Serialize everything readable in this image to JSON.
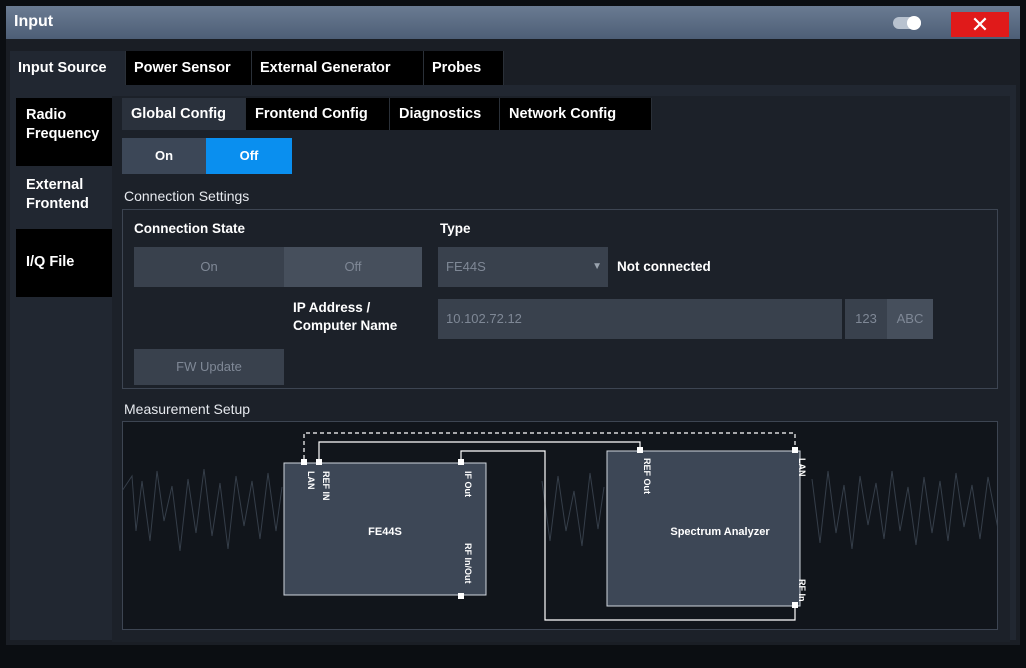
{
  "window": {
    "title": "Input"
  },
  "top_tabs": [
    "Input Source",
    "Power Sensor",
    "External Generator",
    "Probes"
  ],
  "side_tabs": [
    "Radio Frequency",
    "External Frontend",
    "I/Q File"
  ],
  "sub_tabs": [
    "Global Config",
    "Frontend Config",
    "Diagnostics",
    "Network Config"
  ],
  "global_state": {
    "on_label": "On",
    "off_label": "Off",
    "selected": "Off"
  },
  "connection_settings": {
    "title": "Connection Settings",
    "state_label": "Connection State",
    "state_on": "On",
    "state_off": "Off",
    "type_label": "Type",
    "type_value": "FE44S",
    "status": "Not connected",
    "ip_label_line1": "IP Address /",
    "ip_label_line2": "Computer Name",
    "ip_value": "10.102.72.12",
    "keypad_numeric": "123",
    "keypad_alpha": "ABC",
    "fw_update": "FW Update"
  },
  "measurement_setup": {
    "title": "Measurement Setup",
    "frontend": {
      "name": "FE44S",
      "ports": [
        "LAN",
        "REF IN",
        "IF Out",
        "RF In/Out"
      ]
    },
    "analyzer": {
      "name": "Spectrum Analyzer",
      "ports": [
        "REF Out",
        "LAN",
        "RF In"
      ]
    }
  },
  "colors": {
    "accent": "#0a8fef",
    "close": "#e01a1a",
    "titlebar": "#5a6b82"
  }
}
